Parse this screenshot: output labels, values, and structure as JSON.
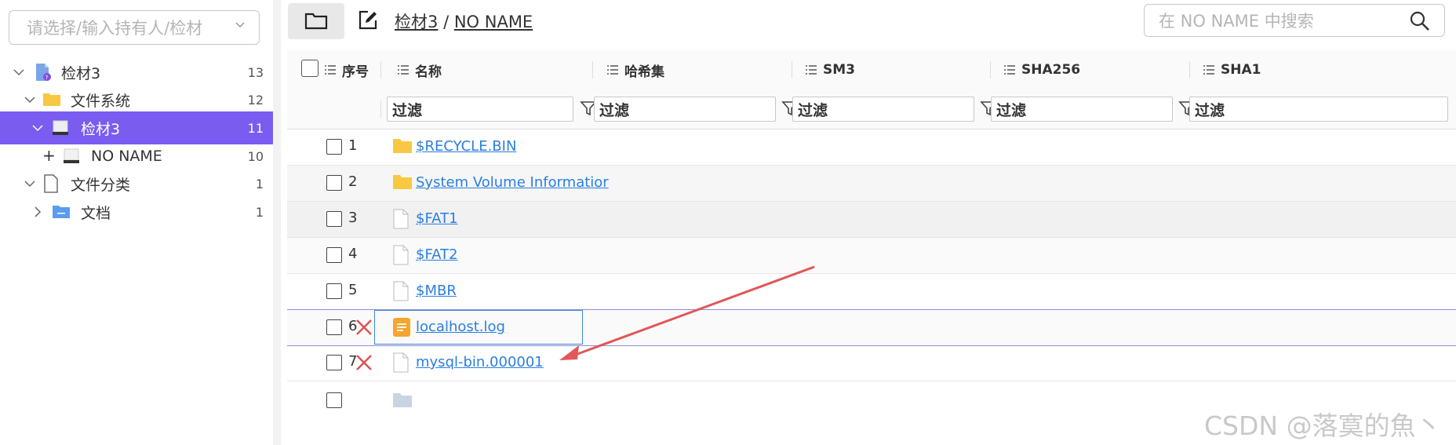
{
  "left_panel": {
    "owner_select_placeholder": "请选择/输入持有人/检材",
    "tree": [
      {
        "label": "检材3",
        "count": "13"
      },
      {
        "label": "文件系统",
        "count": "12"
      },
      {
        "label": "检材3",
        "count": "11"
      },
      {
        "label": "NO NAME",
        "count": "10"
      },
      {
        "label": "文件分类",
        "count": "1"
      },
      {
        "label": "文档",
        "count": "1"
      }
    ],
    "expand_plus": "+"
  },
  "toolbar": {
    "breadcrumb_root": "检材3",
    "breadcrumb_sep": "/",
    "breadcrumb_current": "NO NAME",
    "search_placeholder": "在 NO NAME 中搜索"
  },
  "table": {
    "columns": [
      "序号",
      "名称",
      "哈希集",
      "SM3",
      "SHA256",
      "SHA1"
    ],
    "filter_placeholder": "过滤",
    "rows": [
      {
        "num": "1",
        "name": "$RECYCLE.BIN",
        "icon": "folder-icon",
        "deleted": false
      },
      {
        "num": "2",
        "name": "System Volume Informatior",
        "icon": "folder-icon",
        "deleted": false
      },
      {
        "num": "3",
        "name": "$FAT1",
        "icon": "file-icon",
        "deleted": false
      },
      {
        "num": "4",
        "name": "$FAT2",
        "icon": "file-icon",
        "deleted": false
      },
      {
        "num": "5",
        "name": "$MBR",
        "icon": "file-icon",
        "deleted": false
      },
      {
        "num": "6",
        "name": "localhost.log",
        "icon": "log-file-icon",
        "deleted": true
      },
      {
        "num": "7",
        "name": "mysql-bin.000001",
        "icon": "file-icon",
        "deleted": true
      }
    ]
  },
  "colors": {
    "selection": "#7a5cf0",
    "link": "#2a7fe0",
    "deleted_mark": "#e05050",
    "annotation_arrow": "#e05858"
  },
  "watermark": "CSDN @落寞的魚丶"
}
